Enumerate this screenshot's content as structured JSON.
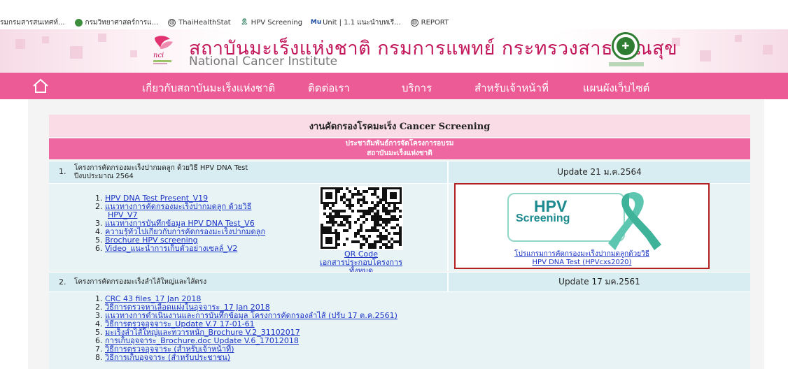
{
  "bookmarks": [
    {
      "label": "รมกรมสารสนเทศท์...",
      "icon": "none"
    },
    {
      "label": "กรมวิทยาศาสตร์การแ...",
      "icon": "green-logo-icon"
    },
    {
      "label": "ThaiHealthStat",
      "icon": "globe-icon"
    },
    {
      "label": "HPV Screening",
      "icon": "ribbon-icon"
    },
    {
      "label": "Unit | 1.1 แนะนำบทเรี...",
      "icon": "mu-icon"
    },
    {
      "label": "REPORT",
      "icon": "globe-icon"
    }
  ],
  "site": {
    "title_th": "สถาบันมะเร็งแห่งชาติ กรมการแพทย์ กระทรวงสาธารณสุข",
    "title_en": "National Cancer Institute"
  },
  "nav": {
    "items": [
      "เกี่ยวกับสถาบันมะเร็งแห่งชาติ",
      "ติดต่อเรา",
      "บริการ",
      "สำหรับเจ้าหน้าที่",
      "แผนผังเว็บไซต์"
    ]
  },
  "page": {
    "title": "งานคัดกรองโรคมะเร็ง Cancer Screening",
    "subtitle_line1": "ประชาสัมพันธ์การจัดโครงการอบรม",
    "subtitle_line2": "สถาบันมะเร็งแห่งชาติ"
  },
  "section1": {
    "number": "1.",
    "title_line1": "โครงการคัดกรองมะเร็งปากมดลูก ด้วยวิธี HPV DNA Test",
    "title_line2": "ปีงบประมาณ 2564",
    "update": "Update 21 ม.ค.2564",
    "links": [
      {
        "num": "1.",
        "text": "HPV DNA Test Present_V19"
      },
      {
        "num": "2.",
        "text": "แนวทางการคัดกรองมะเร็งปากมดลูก ด้วยวิธี"
      },
      {
        "num": "",
        "text": "HPV_V7"
      },
      {
        "num": "3.",
        "text": "แนวทางการบันทึกข้อมูล HPV DNA Test_V6"
      },
      {
        "num": "4.",
        "text": "ความรู้ทั่วไปเกี่ยวกับการคัดกรองมะเร็งปากมดลูก"
      },
      {
        "num": "5.",
        "text": "Brochure HPV screening"
      },
      {
        "num": "6.",
        "text": "Video_แนะนำการเก็บตัวอย่างเซลล์_V2"
      }
    ],
    "qr_label": "QR Code",
    "qr_sublabel": "เอกสารประกอบโครงการทั้งหมด",
    "hpv_logo_big": "HPV",
    "hpv_logo_small": "Screening",
    "hpv_caption_line1": "โปรแกรมการคัดกรองมะเร็งปากมดลูกด้วยวิธี",
    "hpv_caption_line2": "HPV DNA Test (HPVcxs2020)",
    "ribbon_color": "#5cc6b0"
  },
  "section2": {
    "number": "2.",
    "title": "โครงการคัดกรองมะเร็งลำไส้ใหญ่และไส้ตรง",
    "update": "Update 17 มค.2561",
    "links": [
      {
        "num": "1.",
        "text": "CRC 43 files_17 Jan 2018"
      },
      {
        "num": "2.",
        "text": "วิธีการตรวจหาเลือดแฝงในอุจจาระ_17 Jan 2018"
      },
      {
        "num": "3.",
        "text": "แนวทางการดำเนินงานและการบันทึกข้อมูล โครงการคัดกรองลำไส้ (ปรับ 17 ต.ค.2561)"
      },
      {
        "num": "4.",
        "text": "วิธีการตรวจอุจจาระ_Update V.7 17-01-61"
      },
      {
        "num": "5.",
        "text": "มะเร็งลำไส้ใหญ่และทวารหนัก_Brochure V.2_31102017"
      },
      {
        "num": "6.",
        "text": "การเก็บอุจจาระ_Brochure.doc Update V.6_17012018"
      },
      {
        "num": "7.",
        "text": "วิธีการตรวจอุจจาระ (สำหรับเจ้าหน้าที่)"
      },
      {
        "num": "8.",
        "text": "วิธีการเก็บอุจจาระ (สำหรับประชาชน)"
      }
    ]
  },
  "colors": {
    "nav_pink": "#ec5b95",
    "title_pink": "#c2185b",
    "row_blue": "#d8edf1",
    "link_blue": "#1a33c6",
    "highlight_red": "#b22020"
  }
}
